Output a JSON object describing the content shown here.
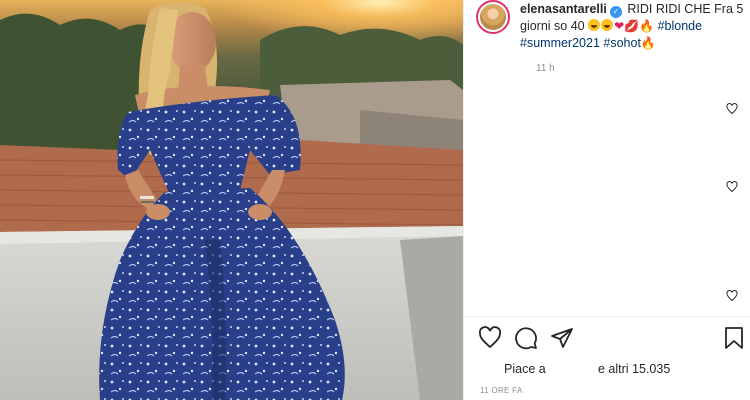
{
  "post": {
    "image_alt": "Woman in blue floral off-shoulder dress sitting on a white wall at sunset",
    "username": "elenasantarelli",
    "verified_badge": "✓",
    "caption_text": "RIDI RIDI CHE Fra 5 giorni so 40",
    "caption_emojis": [
      "😄",
      "😂",
      "❤",
      "💋",
      "🔥"
    ],
    "hashtags": [
      "#blonde",
      "#summer2021",
      "#sohot"
    ],
    "trailing_emoji": "🔥",
    "relative_time": "11 h",
    "likes_prefix": "Piace a",
    "likes_suffix": "e altri 15.035",
    "timestamp": "11 ORE FA"
  },
  "icons": {
    "like": "heart-outline-icon",
    "comment": "comment-bubble-icon",
    "share": "paper-plane-icon",
    "save": "bookmark-icon",
    "comment_like": "small-heart-icon"
  },
  "colors": {
    "hashtag": "#00376b",
    "verified": "#3897f0",
    "muted_text": "#8e8e8e",
    "dress": "#2a3f8a"
  }
}
